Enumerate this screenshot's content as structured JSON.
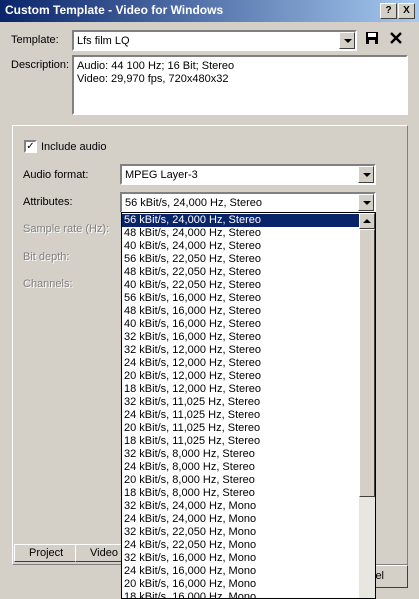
{
  "window": {
    "title": "Custom Template - Video for Windows",
    "help_btn": "?",
    "close_btn": "X"
  },
  "template": {
    "label": "Template:",
    "value": "Lfs film LQ"
  },
  "description": {
    "label": "Description:",
    "line1": "Audio: 44 100 Hz; 16 Bit; Stereo",
    "line2": "Video: 29,970 fps, 720x480x32"
  },
  "audio": {
    "include_label": "Include audio",
    "include_checked": true,
    "format_label": "Audio format:",
    "format_value": "MPEG Layer-3",
    "attributes_label": "Attributes:",
    "attributes_value": "56 kBit/s, 24,000 Hz, Stereo",
    "sample_rate_label": "Sample rate (Hz):",
    "bit_depth_label": "Bit depth:",
    "channels_label": "Channels:"
  },
  "attributes_options": [
    "56 kBit/s, 24,000 Hz, Stereo",
    "48 kBit/s, 24,000 Hz, Stereo",
    "40 kBit/s, 24,000 Hz, Stereo",
    "56 kBit/s, 22,050 Hz, Stereo",
    "48 kBit/s, 22,050 Hz, Stereo",
    "40 kBit/s, 22,050 Hz, Stereo",
    "56 kBit/s, 16,000 Hz, Stereo",
    "48 kBit/s, 16,000 Hz, Stereo",
    "40 kBit/s, 16,000 Hz, Stereo",
    "32 kBit/s, 16,000 Hz, Stereo",
    "32 kBit/s, 12,000 Hz, Stereo",
    "24 kBit/s, 12,000 Hz, Stereo",
    "20 kBit/s, 12,000 Hz, Stereo",
    "18 kBit/s, 12,000 Hz, Stereo",
    "32 kBit/s, 11,025 Hz, Stereo",
    "24 kBit/s, 11,025 Hz, Stereo",
    "20 kBit/s, 11,025 Hz, Stereo",
    "18 kBit/s, 11,025 Hz, Stereo",
    "32 kBit/s, 8,000 Hz, Stereo",
    "24 kBit/s, 8,000 Hz, Stereo",
    "20 kBit/s, 8,000 Hz, Stereo",
    "18 kBit/s, 8,000 Hz, Stereo",
    "32 kBit/s, 24,000 Hz, Mono",
    "24 kBit/s, 24,000 Hz, Mono",
    "32 kBit/s, 22,050 Hz, Mono",
    "24 kBit/s, 22,050 Hz, Mono",
    "32 kBit/s, 16,000 Hz, Mono",
    "24 kBit/s, 16,000 Hz, Mono",
    "20 kBit/s, 16,000 Hz, Mono",
    "18 kBit/s, 16,000 Hz, Mono"
  ],
  "tabs": [
    {
      "label": "Project"
    },
    {
      "label": "Video"
    }
  ],
  "buttons": {
    "cancel_partial": "el"
  },
  "colors": {
    "title_start": "#0a246a",
    "title_end": "#a6caf0",
    "selection": "#0a246a",
    "face": "#d4d0c8"
  }
}
